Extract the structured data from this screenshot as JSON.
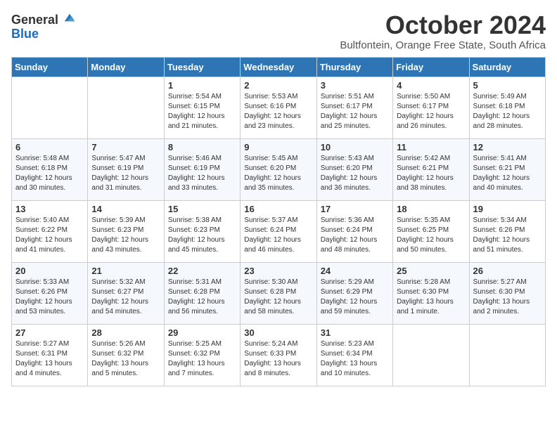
{
  "logo": {
    "general": "General",
    "blue": "Blue"
  },
  "header": {
    "month": "October 2024",
    "location": "Bultfontein, Orange Free State, South Africa"
  },
  "days_of_week": [
    "Sunday",
    "Monday",
    "Tuesday",
    "Wednesday",
    "Thursday",
    "Friday",
    "Saturday"
  ],
  "weeks": [
    [
      {
        "day": "",
        "content": ""
      },
      {
        "day": "",
        "content": ""
      },
      {
        "day": "1",
        "content": "Sunrise: 5:54 AM\nSunset: 6:15 PM\nDaylight: 12 hours and 21 minutes."
      },
      {
        "day": "2",
        "content": "Sunrise: 5:53 AM\nSunset: 6:16 PM\nDaylight: 12 hours and 23 minutes."
      },
      {
        "day": "3",
        "content": "Sunrise: 5:51 AM\nSunset: 6:17 PM\nDaylight: 12 hours and 25 minutes."
      },
      {
        "day": "4",
        "content": "Sunrise: 5:50 AM\nSunset: 6:17 PM\nDaylight: 12 hours and 26 minutes."
      },
      {
        "day": "5",
        "content": "Sunrise: 5:49 AM\nSunset: 6:18 PM\nDaylight: 12 hours and 28 minutes."
      }
    ],
    [
      {
        "day": "6",
        "content": "Sunrise: 5:48 AM\nSunset: 6:18 PM\nDaylight: 12 hours and 30 minutes."
      },
      {
        "day": "7",
        "content": "Sunrise: 5:47 AM\nSunset: 6:19 PM\nDaylight: 12 hours and 31 minutes."
      },
      {
        "day": "8",
        "content": "Sunrise: 5:46 AM\nSunset: 6:19 PM\nDaylight: 12 hours and 33 minutes."
      },
      {
        "day": "9",
        "content": "Sunrise: 5:45 AM\nSunset: 6:20 PM\nDaylight: 12 hours and 35 minutes."
      },
      {
        "day": "10",
        "content": "Sunrise: 5:43 AM\nSunset: 6:20 PM\nDaylight: 12 hours and 36 minutes."
      },
      {
        "day": "11",
        "content": "Sunrise: 5:42 AM\nSunset: 6:21 PM\nDaylight: 12 hours and 38 minutes."
      },
      {
        "day": "12",
        "content": "Sunrise: 5:41 AM\nSunset: 6:21 PM\nDaylight: 12 hours and 40 minutes."
      }
    ],
    [
      {
        "day": "13",
        "content": "Sunrise: 5:40 AM\nSunset: 6:22 PM\nDaylight: 12 hours and 41 minutes."
      },
      {
        "day": "14",
        "content": "Sunrise: 5:39 AM\nSunset: 6:23 PM\nDaylight: 12 hours and 43 minutes."
      },
      {
        "day": "15",
        "content": "Sunrise: 5:38 AM\nSunset: 6:23 PM\nDaylight: 12 hours and 45 minutes."
      },
      {
        "day": "16",
        "content": "Sunrise: 5:37 AM\nSunset: 6:24 PM\nDaylight: 12 hours and 46 minutes."
      },
      {
        "day": "17",
        "content": "Sunrise: 5:36 AM\nSunset: 6:24 PM\nDaylight: 12 hours and 48 minutes."
      },
      {
        "day": "18",
        "content": "Sunrise: 5:35 AM\nSunset: 6:25 PM\nDaylight: 12 hours and 50 minutes."
      },
      {
        "day": "19",
        "content": "Sunrise: 5:34 AM\nSunset: 6:26 PM\nDaylight: 12 hours and 51 minutes."
      }
    ],
    [
      {
        "day": "20",
        "content": "Sunrise: 5:33 AM\nSunset: 6:26 PM\nDaylight: 12 hours and 53 minutes."
      },
      {
        "day": "21",
        "content": "Sunrise: 5:32 AM\nSunset: 6:27 PM\nDaylight: 12 hours and 54 minutes."
      },
      {
        "day": "22",
        "content": "Sunrise: 5:31 AM\nSunset: 6:28 PM\nDaylight: 12 hours and 56 minutes."
      },
      {
        "day": "23",
        "content": "Sunrise: 5:30 AM\nSunset: 6:28 PM\nDaylight: 12 hours and 58 minutes."
      },
      {
        "day": "24",
        "content": "Sunrise: 5:29 AM\nSunset: 6:29 PM\nDaylight: 12 hours and 59 minutes."
      },
      {
        "day": "25",
        "content": "Sunrise: 5:28 AM\nSunset: 6:30 PM\nDaylight: 13 hours and 1 minute."
      },
      {
        "day": "26",
        "content": "Sunrise: 5:27 AM\nSunset: 6:30 PM\nDaylight: 13 hours and 2 minutes."
      }
    ],
    [
      {
        "day": "27",
        "content": "Sunrise: 5:27 AM\nSunset: 6:31 PM\nDaylight: 13 hours and 4 minutes."
      },
      {
        "day": "28",
        "content": "Sunrise: 5:26 AM\nSunset: 6:32 PM\nDaylight: 13 hours and 5 minutes."
      },
      {
        "day": "29",
        "content": "Sunrise: 5:25 AM\nSunset: 6:32 PM\nDaylight: 13 hours and 7 minutes."
      },
      {
        "day": "30",
        "content": "Sunrise: 5:24 AM\nSunset: 6:33 PM\nDaylight: 13 hours and 8 minutes."
      },
      {
        "day": "31",
        "content": "Sunrise: 5:23 AM\nSunset: 6:34 PM\nDaylight: 13 hours and 10 minutes."
      },
      {
        "day": "",
        "content": ""
      },
      {
        "day": "",
        "content": ""
      }
    ]
  ]
}
